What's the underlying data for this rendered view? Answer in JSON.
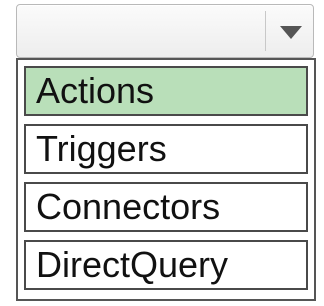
{
  "dropdown": {
    "value": "",
    "arrow_icon": "caret-down-icon",
    "arrow_color": "#555555"
  },
  "options": [
    {
      "label": "Actions",
      "selected": true
    },
    {
      "label": "Triggers",
      "selected": false
    },
    {
      "label": "Connectors",
      "selected": false
    },
    {
      "label": "DirectQuery",
      "selected": false
    }
  ],
  "colors": {
    "selected_background": "#b9dfb9",
    "border": "#4a4a4a"
  }
}
